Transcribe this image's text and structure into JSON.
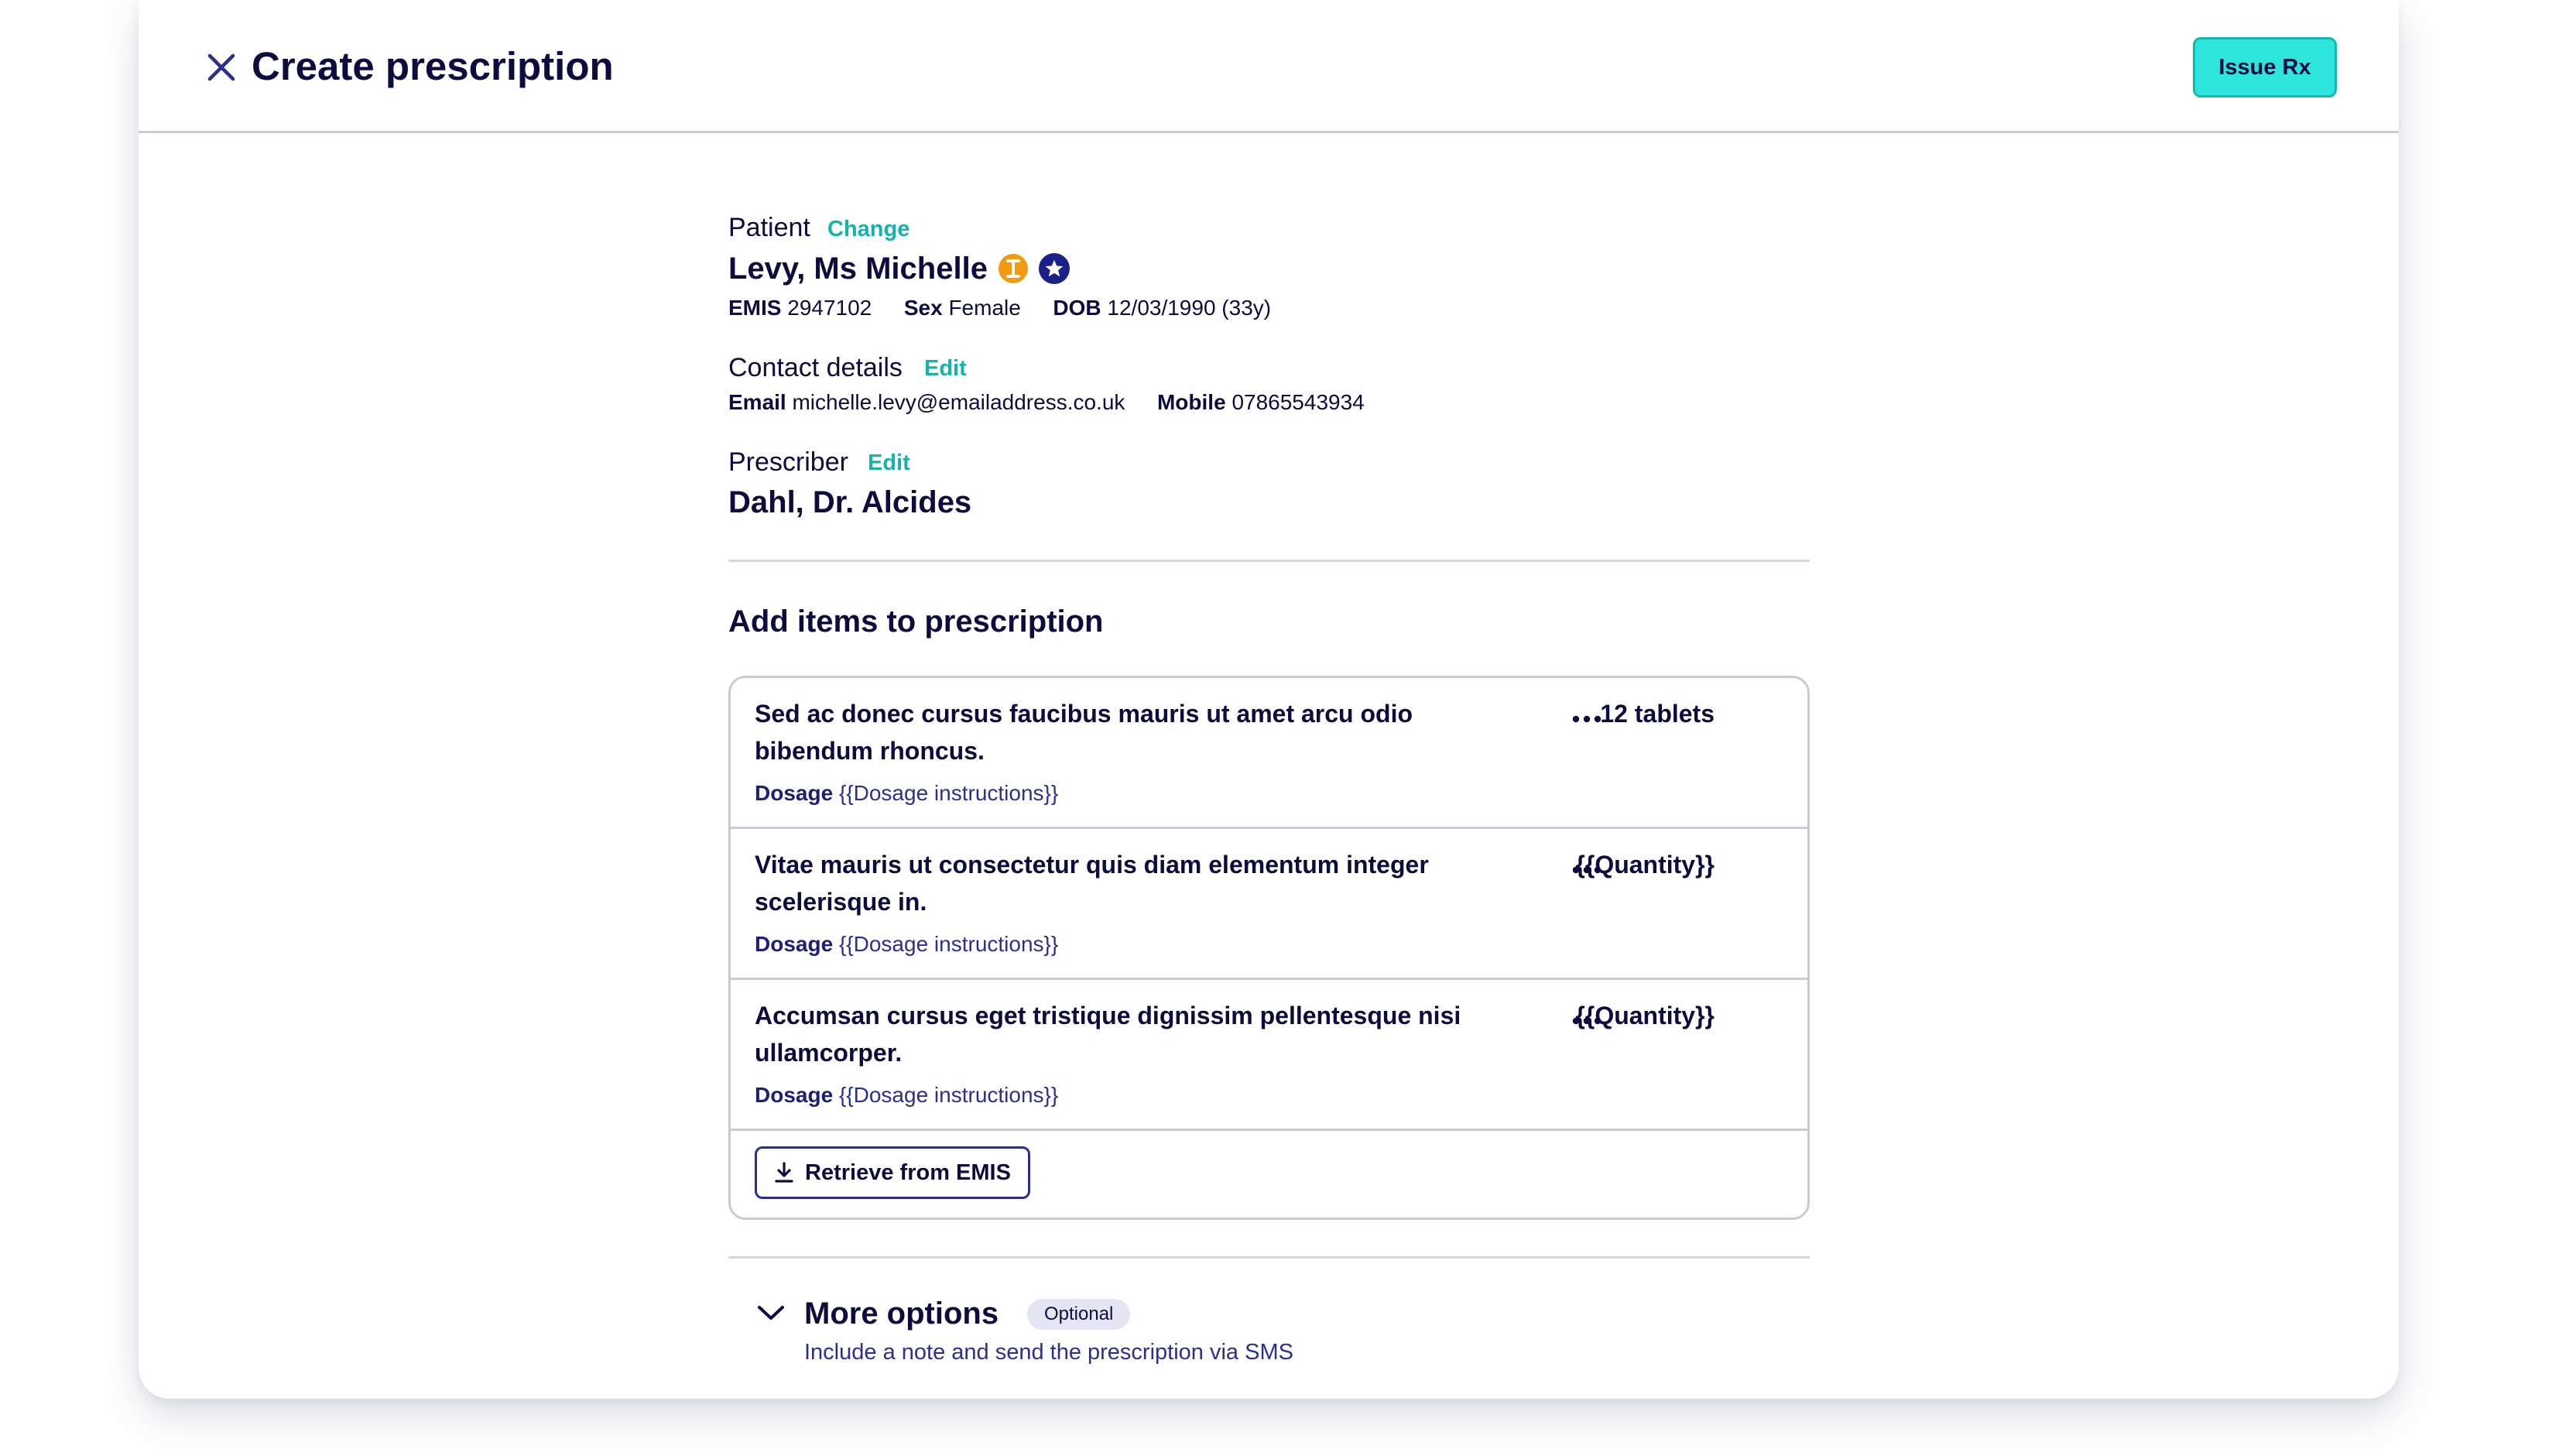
{
  "header": {
    "title": "Create prescription",
    "issue_label": "Issue Rx"
  },
  "patient": {
    "section_label": "Patient",
    "change_label": "Change",
    "name": "Levy, Ms Michelle",
    "emis_key": "EMIS",
    "emis_value": "2947102",
    "sex_key": "Sex",
    "sex_value": "Female",
    "dob_key": "DOB",
    "dob_value": "12/03/1990 (33y)",
    "badge_orange_glyph": "I",
    "badge_orange_color": "#f29b10",
    "badge_navy_color": "#1b1f8a"
  },
  "contact": {
    "section_label": "Contact details",
    "edit_label": "Edit",
    "email_key": "Email",
    "email_value": "michelle.levy@emailaddress.co.uk",
    "mobile_key": "Mobile",
    "mobile_value": "07865543934"
  },
  "prescriber": {
    "section_label": "Prescriber",
    "edit_label": "Edit",
    "name": "Dahl, Dr. Alcides"
  },
  "items_section": {
    "title": "Add items to prescription",
    "items": [
      {
        "name": "Sed ac donec cursus faucibus mauris ut amet arcu odio bibendum rhoncus.",
        "quantity": "12 tablets",
        "dosage_key": "Dosage",
        "dosage_value": "{{Dosage instructions}}"
      },
      {
        "name": "Vitae mauris ut consectetur quis diam elementum integer scelerisque in.",
        "quantity": "{{Quantity}}",
        "dosage_key": "Dosage",
        "dosage_value": "{{Dosage instructions}}"
      },
      {
        "name": "Accumsan cursus eget tristique dignissim pellentesque nisi ullamcorper.",
        "quantity": "{{Quantity}}",
        "dosage_key": "Dosage",
        "dosage_value": "{{Dosage instructions}}"
      }
    ],
    "retrieve_label": "Retrieve from EMIS"
  },
  "more_options": {
    "title": "More options",
    "badge": "Optional",
    "subtitle": "Include a note and send the prescription via SMS"
  },
  "colors": {
    "accent_teal": "#2ee5db",
    "link_teal": "#17b3aa",
    "navy_text": "#0c0c3f"
  }
}
